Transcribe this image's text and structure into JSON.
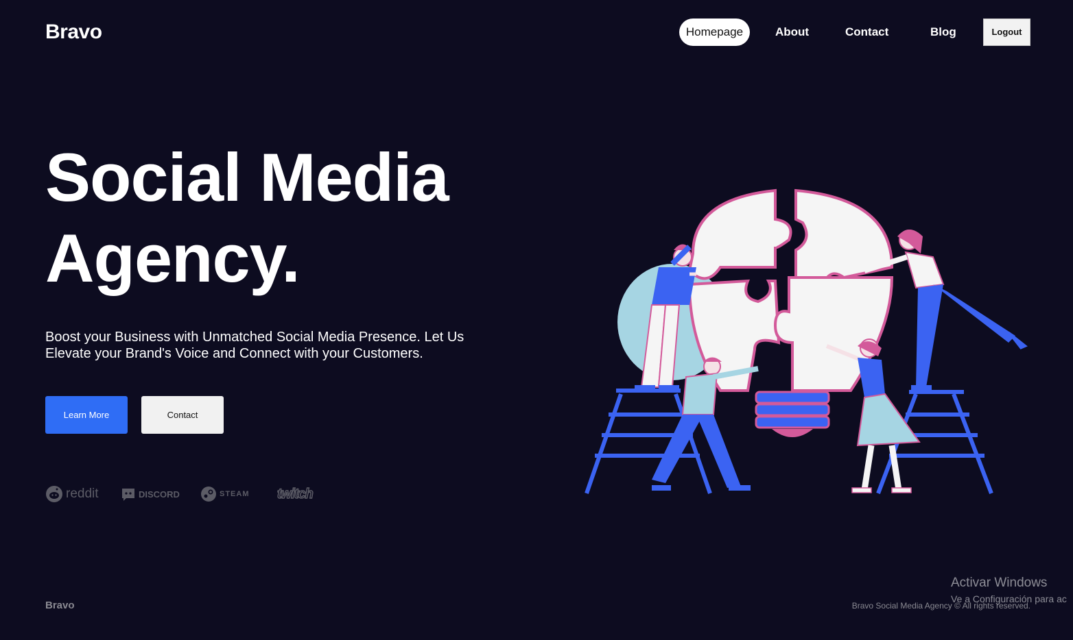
{
  "header": {
    "logo": "Bravo",
    "nav": {
      "homepage": "Homepage",
      "about": "About",
      "contact": "Contact",
      "blog": "Blog",
      "logout": "Logout"
    }
  },
  "hero": {
    "title_line1": "Social Media",
    "title_line2": "Agency.",
    "subtitle": "Boost your Business with Unmatched Social Media Presence. Let Us Elevate your Brand's Voice and Connect with your Customers.",
    "primary_button": "Learn More",
    "secondary_button": "Contact"
  },
  "brands": {
    "reddit": "reddit",
    "discord": "DISCORD",
    "steam": "STEAM",
    "twitch": "twitch"
  },
  "footer": {
    "logo": "Bravo",
    "copyright": "Bravo Social Media Agency © All rights reserved."
  },
  "windows_watermark": {
    "title": "Activar Windows",
    "subtitle": "Ve a Configuración para ac"
  },
  "colors": {
    "background": "#0d0c20",
    "accent": "#2f6df5",
    "illustration_blue": "#3b63f2",
    "illustration_pink": "#d35a9a",
    "illustration_light": "#a6d5e3"
  },
  "icons": [
    "reddit-icon",
    "discord-icon",
    "steam-icon",
    "twitch-logo"
  ]
}
